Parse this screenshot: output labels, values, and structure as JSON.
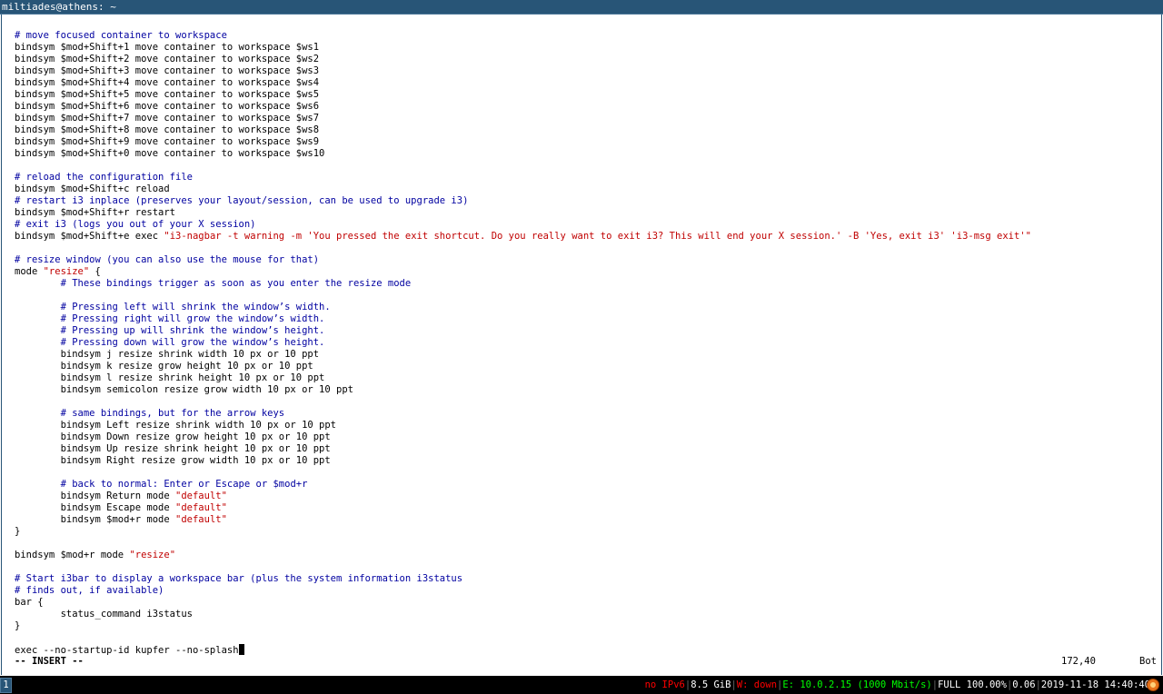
{
  "window": {
    "title": "miltiades@athens: ~"
  },
  "editor": {
    "lines": [
      [],
      [
        {
          "t": "# move focused container to workspace",
          "c": "cmt"
        }
      ],
      [
        {
          "t": "bindsym $mod+Shift+1 move container to workspace $ws1"
        }
      ],
      [
        {
          "t": "bindsym $mod+Shift+2 move container to workspace $ws2"
        }
      ],
      [
        {
          "t": "bindsym $mod+Shift+3 move container to workspace $ws3"
        }
      ],
      [
        {
          "t": "bindsym $mod+Shift+4 move container to workspace $ws4"
        }
      ],
      [
        {
          "t": "bindsym $mod+Shift+5 move container to workspace $ws5"
        }
      ],
      [
        {
          "t": "bindsym $mod+Shift+6 move container to workspace $ws6"
        }
      ],
      [
        {
          "t": "bindsym $mod+Shift+7 move container to workspace $ws7"
        }
      ],
      [
        {
          "t": "bindsym $mod+Shift+8 move container to workspace $ws8"
        }
      ],
      [
        {
          "t": "bindsym $mod+Shift+9 move container to workspace $ws9"
        }
      ],
      [
        {
          "t": "bindsym $mod+Shift+0 move container to workspace $ws10"
        }
      ],
      [],
      [
        {
          "t": "# reload the configuration file",
          "c": "cmt"
        }
      ],
      [
        {
          "t": "bindsym $mod+Shift+c reload"
        }
      ],
      [
        {
          "t": "# restart i3 inplace (preserves your layout/session, can be used to upgrade i3)",
          "c": "cmt"
        }
      ],
      [
        {
          "t": "bindsym $mod+Shift+r restart"
        }
      ],
      [
        {
          "t": "# exit i3 (logs you out of your X session)",
          "c": "cmt"
        }
      ],
      [
        {
          "t": "bindsym $mod+Shift+e exec "
        },
        {
          "t": "\"i3-nagbar -t warning -m 'You pressed the exit shortcut. Do you really want to exit i3? This will end your X session.' -B 'Yes, exit i3' 'i3-msg exit'\"",
          "c": "str"
        }
      ],
      [],
      [
        {
          "t": "# resize window (you can also use the mouse for that)",
          "c": "cmt"
        }
      ],
      [
        {
          "t": "mode "
        },
        {
          "t": "\"resize\"",
          "c": "str"
        },
        {
          "t": " {"
        }
      ],
      [
        {
          "t": "        "
        },
        {
          "t": "# These bindings trigger as soon as you enter the resize mode",
          "c": "cmt"
        }
      ],
      [],
      [
        {
          "t": "        "
        },
        {
          "t": "# Pressing left will shrink the window’s width.",
          "c": "cmt"
        }
      ],
      [
        {
          "t": "        "
        },
        {
          "t": "# Pressing right will grow the window’s width.",
          "c": "cmt"
        }
      ],
      [
        {
          "t": "        "
        },
        {
          "t": "# Pressing up will shrink the window’s height.",
          "c": "cmt"
        }
      ],
      [
        {
          "t": "        "
        },
        {
          "t": "# Pressing down will grow the window’s height.",
          "c": "cmt"
        }
      ],
      [
        {
          "t": "        bindsym j resize shrink width 10 px or 10 ppt"
        }
      ],
      [
        {
          "t": "        bindsym k resize grow height 10 px or 10 ppt"
        }
      ],
      [
        {
          "t": "        bindsym l resize shrink height 10 px or 10 ppt"
        }
      ],
      [
        {
          "t": "        bindsym semicolon resize grow width 10 px or 10 ppt"
        }
      ],
      [],
      [
        {
          "t": "        "
        },
        {
          "t": "# same bindings, but for the arrow keys",
          "c": "cmt"
        }
      ],
      [
        {
          "t": "        bindsym Left resize shrink width 10 px or 10 ppt"
        }
      ],
      [
        {
          "t": "        bindsym Down resize grow height 10 px or 10 ppt"
        }
      ],
      [
        {
          "t": "        bindsym Up resize shrink height 10 px or 10 ppt"
        }
      ],
      [
        {
          "t": "        bindsym Right resize grow width 10 px or 10 ppt"
        }
      ],
      [],
      [
        {
          "t": "        "
        },
        {
          "t": "# back to normal: Enter or Escape or $mod+r",
          "c": "cmt"
        }
      ],
      [
        {
          "t": "        bindsym Return mode "
        },
        {
          "t": "\"default\"",
          "c": "str"
        }
      ],
      [
        {
          "t": "        bindsym Escape mode "
        },
        {
          "t": "\"default\"",
          "c": "str"
        }
      ],
      [
        {
          "t": "        bindsym $mod+r mode "
        },
        {
          "t": "\"default\"",
          "c": "str"
        }
      ],
      [
        {
          "t": "}"
        }
      ],
      [],
      [
        {
          "t": "bindsym $mod+r mode "
        },
        {
          "t": "\"resize\"",
          "c": "str"
        }
      ],
      [],
      [
        {
          "t": "# Start i3bar to display a workspace bar (plus the system information i3status",
          "c": "cmt"
        }
      ],
      [
        {
          "t": "# finds out, if available)",
          "c": "cmt"
        }
      ],
      [
        {
          "t": "bar {"
        }
      ],
      [
        {
          "t": "        status_command i3status"
        }
      ],
      [
        {
          "t": "}"
        }
      ],
      [],
      [
        {
          "t": "exec --no-startup-id kupfer --no-splash"
        },
        {
          "cursor": true
        }
      ]
    ]
  },
  "statusline": {
    "mode": "-- INSERT --",
    "position": "172,40",
    "scroll": "Bot"
  },
  "bar": {
    "workspace": "1",
    "ipv6": "no IPv6",
    "memory": "8.5 GiB",
    "wireless": "W: down",
    "ethernet": "E: 10.0.2.15 (1000 Mbit/s)",
    "battery": "FULL 100.00%",
    "load": "0.06",
    "datetime": "2019-11-18 14:40:40",
    "tray_icon": "kupfer-icon",
    "colors": {
      "bad": "#ff0000",
      "good": "#00ff00",
      "accent": "#285577"
    }
  }
}
